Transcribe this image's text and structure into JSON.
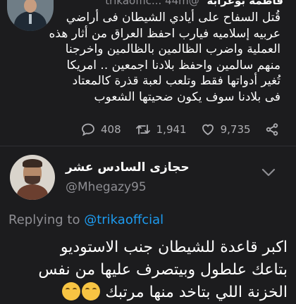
{
  "original_tweet": {
    "author_name": "فاطمة بوعرابة",
    "handle": "@trikaoffic...",
    "time": "44m",
    "text_lines": [
      "قُتل السفاح على أيادي الشيطان فى أراضي",
      "عربيه إسلاميه فيارب احفظ العراق من أثار هذه",
      "العملية واضرب الظالمين بالظالمين واخرجنا",
      "منهم سالمين واحفظ بلادنا اجمعين .. امريكا",
      "تُغير أدواتها فقط وتلعب لعبة قذرة كالمعتاد",
      "فى بلادنا سوف يكون ضحيتها الشعوب"
    ],
    "actions": {
      "replies": "408",
      "retweets": "1,941",
      "likes": "9,735"
    }
  },
  "reply_tweet": {
    "author_name": "حجازى السادس عشر",
    "handle": "@Mhegazy95",
    "replying_prefix": "Replying to",
    "replying_to": "@trikaoffcial",
    "text_lines": [
      "اكبر قاعدة للشيطان جنب الاستوديو",
      "بتاعك علطول وبيتصرف عليها من نفس",
      "الخزنة اللي بتاخد منها مرتبك"
    ],
    "emoji_icons": [
      "tears-of-joy-emoji",
      "tears-of-joy-emoji"
    ]
  }
}
